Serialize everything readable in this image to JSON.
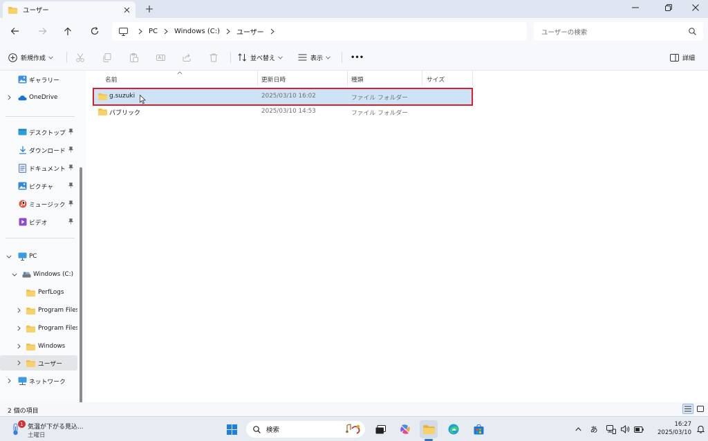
{
  "window": {
    "tab_title": "ユーザー",
    "new_tab": "+"
  },
  "address": {
    "crumbs": [
      "PC",
      "Windows (C:)",
      "ユーザー"
    ]
  },
  "search": {
    "placeholder": "ユーザーの検索"
  },
  "commands": {
    "new": "新規作成",
    "sort": "並べ替え",
    "view": "表示",
    "more": "•••",
    "details": "詳細"
  },
  "sidebar": {
    "gallery": "ギャラリー",
    "onedrive": "OneDrive",
    "quick": [
      {
        "label": "デスクトップ",
        "icon": "desktop-icon"
      },
      {
        "label": "ダウンロード",
        "icon": "download-icon"
      },
      {
        "label": "ドキュメント",
        "icon": "document-icon"
      },
      {
        "label": "ピクチャ",
        "icon": "pictures-icon"
      },
      {
        "label": "ミュージック",
        "icon": "music-icon"
      },
      {
        "label": "ビデオ",
        "icon": "video-icon"
      }
    ],
    "pc": "PC",
    "drive": "Windows (C:)",
    "folders": [
      "PerfLogs",
      "Program Files",
      "Program Files",
      "Windows",
      "ユーザー"
    ],
    "network": "ネットワーク"
  },
  "columns": {
    "name": "名前",
    "modified": "更新日時",
    "type": "種類",
    "size": "サイズ"
  },
  "files": [
    {
      "name": "g.suzuki",
      "modified": "2025/03/10 16:02",
      "type": "ファイル フォルダー",
      "selected": true
    },
    {
      "name": "パブリック",
      "modified": "2025/03/10 14:53",
      "type": "ファイル フォルダー",
      "selected": false
    }
  ],
  "status": {
    "count": "2 個の項目"
  },
  "taskbar": {
    "weather_line1": "気温が下がる見込...",
    "weather_line2": "土曜日",
    "weather_badge": "1",
    "search_label": "検索",
    "ime": "あ",
    "time": "16:27",
    "date": "2025/03/10"
  },
  "colors": {
    "accent": "#2f6fc9",
    "folder": "#f2c14e",
    "selection": "#cfe3f7",
    "highlight_box": "#d61f2e"
  }
}
